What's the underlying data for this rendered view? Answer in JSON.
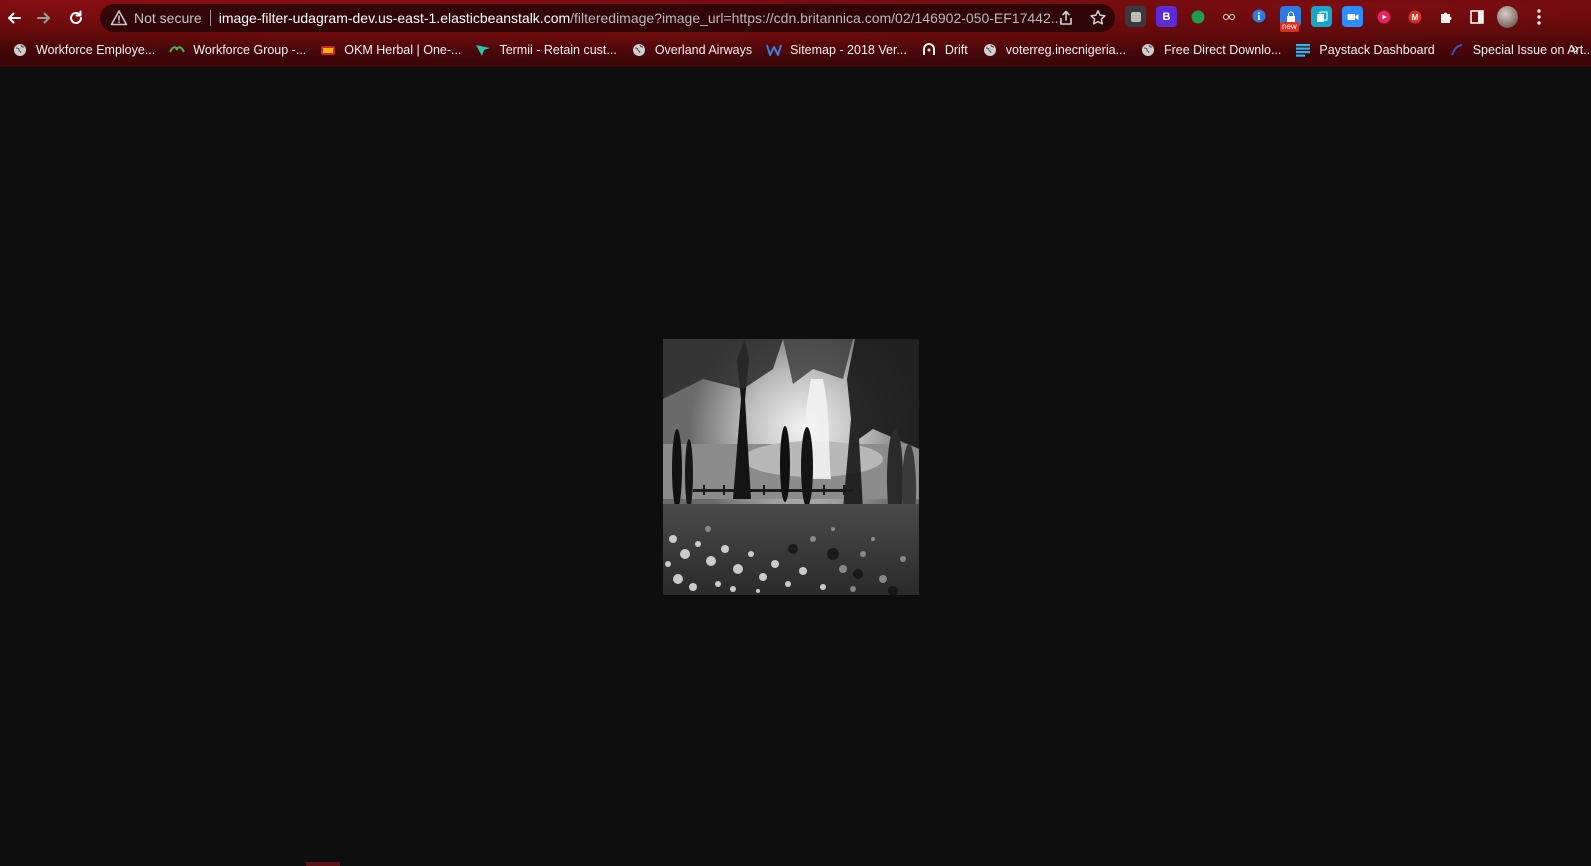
{
  "browser": {
    "nav": {
      "back_icon": "arrow-left-icon",
      "forward_icon": "arrow-right-icon",
      "reload_icon": "reload-icon"
    },
    "omnibox": {
      "security_label": "Not secure",
      "url_host": "image-filter-udagram-dev.us-east-1.elasticbeanstalk.com",
      "url_path": "/filteredimage?image_url=https://cdn.britannica.com/02/146902-050-EF17442..."
    },
    "extensions": [
      {
        "name": "extension-generic",
        "color": "#3a3a3a",
        "label": ""
      },
      {
        "name": "extension-bootstrap",
        "color": "#5b2bd6",
        "label": "B"
      },
      {
        "name": "extension-green-leaf",
        "color": "#1e9e4a",
        "label": ""
      },
      {
        "name": "extension-glasses",
        "color": "#2a2a2a",
        "label": ""
      },
      {
        "name": "extension-info",
        "color": "#2d7be0",
        "label": ""
      },
      {
        "name": "extension-new",
        "color": "#2d7be0",
        "label": "",
        "badge": "new"
      },
      {
        "name": "extension-teal",
        "color": "#17a5c8",
        "label": ""
      },
      {
        "name": "extension-zoom",
        "color": "#2d8cff",
        "label": ""
      },
      {
        "name": "extension-record",
        "color": "#e0245e",
        "label": ""
      },
      {
        "name": "extension-gmail",
        "color": "#d93025",
        "label": "M"
      }
    ]
  },
  "bookmarks": [
    {
      "label": "Workforce Employe...",
      "icon": "globe-icon"
    },
    {
      "label": "Workforce Group -...",
      "icon": "leaf-icon"
    },
    {
      "label": "OKM Herbal | One-...",
      "icon": "herbal-icon"
    },
    {
      "label": "Termii - Retain cust...",
      "icon": "termii-icon"
    },
    {
      "label": "Overland Airways",
      "icon": "globe-icon"
    },
    {
      "label": "Sitemap - 2018 Ver...",
      "icon": "w-icon"
    },
    {
      "label": "Drift",
      "icon": "drift-icon"
    },
    {
      "label": "voterreg.inecnigeria...",
      "icon": "globe-icon"
    },
    {
      "label": "Free Direct Downlo...",
      "icon": "globe-icon"
    },
    {
      "label": "Paystack Dashboard",
      "icon": "paystack-icon"
    },
    {
      "label": "Special Issue on Art...",
      "icon": "article-icon"
    }
  ],
  "bookmarks_more": "»",
  "image": {
    "alt": "filtered-park-photo"
  }
}
